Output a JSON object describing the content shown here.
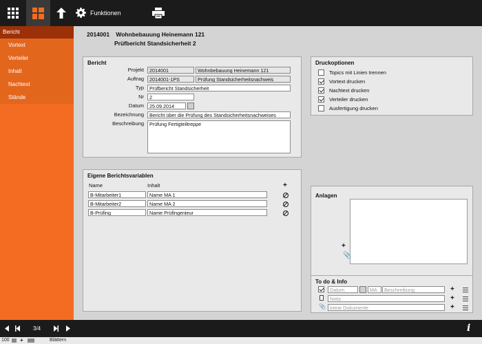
{
  "toolbar": {
    "functions_label": "Funktionen",
    "icons": [
      "grid-icon",
      "tiles-icon",
      "arrow-up-icon",
      "gear-icon",
      "printer-icon"
    ]
  },
  "sidebar": {
    "header": "Bericht",
    "items": [
      {
        "label": "Vortext"
      },
      {
        "label": "Verteiler"
      },
      {
        "label": "Inhalt"
      },
      {
        "label": "Nachtext"
      },
      {
        "label": "Stände"
      }
    ]
  },
  "header": {
    "number": "2014001",
    "project_name": "Wohnbebauung Heinemann 121",
    "report_title": "Prüfbericht Standsicherheit 2"
  },
  "bericht": {
    "title": "Bericht",
    "projekt_label": "Projekt",
    "projekt_nr": "2014001",
    "projekt_name": "Wohnbebauung Heinemann 121",
    "auftrag_label": "Auftrag",
    "auftrag_nr": "2014001-1PS",
    "auftrag_name": "Prüfung Standsicherheitsnachweis",
    "typ_label": "Typ",
    "typ": "Prüfbericht Standsicherheit",
    "nr_label": "Nr",
    "nr": "2",
    "datum_label": "Datum",
    "datum": "25.09.2014",
    "bezeichnung_label": "Bezeichnung",
    "bezeichnung": "Bericht über die Prüfung des Standsicherheitsnachweises",
    "beschreibung_label": "Beschreibung",
    "beschreibung": "Prüfung Fertigteiltreppe"
  },
  "druckoptionen": {
    "title": "Druckoptionen",
    "options": [
      {
        "label": "Topics mit Linien trennen",
        "checked": false
      },
      {
        "label": "Vortext drucken",
        "checked": true
      },
      {
        "label": "Nachtext drucken",
        "checked": true
      },
      {
        "label": "Verteiler drucken",
        "checked": true
      },
      {
        "label": "Ausfertigung drucken",
        "checked": false
      }
    ]
  },
  "variablen": {
    "title": "Eigene Berichtsvariablen",
    "col_name": "Name",
    "col_inhalt": "Inhalt",
    "rows": [
      {
        "name": "B-Mitarbeiter1",
        "inhalt": "Name MA 1"
      },
      {
        "name": "B-Mitarbeiter2",
        "inhalt": "Name MA 2"
      },
      {
        "name": "B-Prüfing",
        "inhalt": "Name Prüfingenieur"
      }
    ]
  },
  "anlagen": {
    "title": "Anlagen"
  },
  "todo": {
    "title": "To do & Info",
    "datum_placeholder": "Datum",
    "ma_placeholder": "MA",
    "beschreibung_placeholder": "Beschreibung",
    "notiz_placeholder": "Notiz",
    "dokumente_placeholder": "keine Dokumente"
  },
  "nav": {
    "page": "3/4",
    "info": "i"
  },
  "status": {
    "zoom": "100",
    "mode": "Blättern"
  }
}
